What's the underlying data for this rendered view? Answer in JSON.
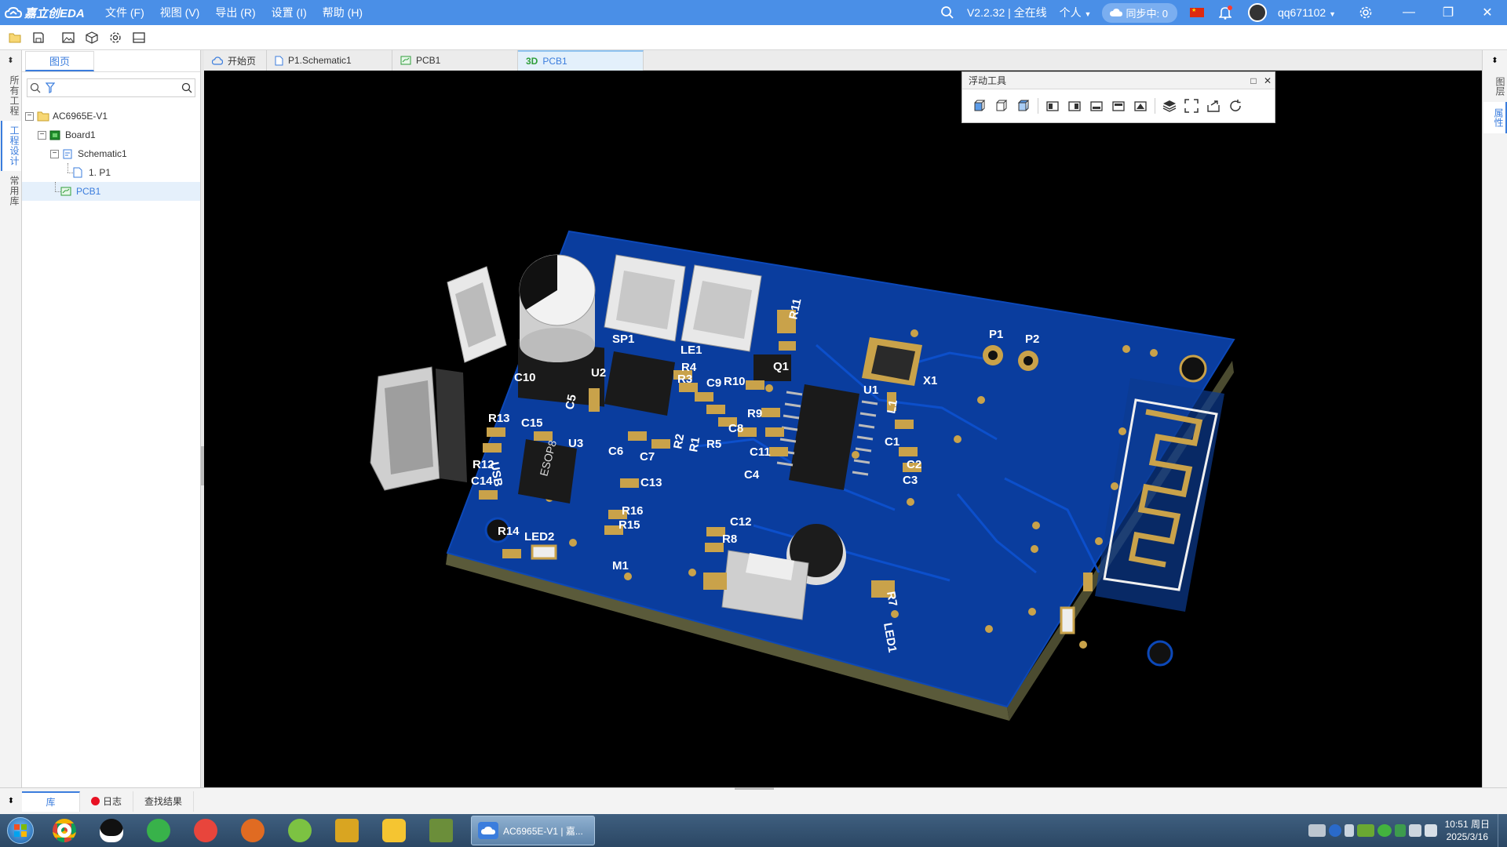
{
  "app": {
    "logo_text": "嘉立创EDA",
    "menus": [
      "文件 (F)",
      "视图 (V)",
      "导出 (R)",
      "设置 (I)",
      "帮助 (H)"
    ],
    "version_status": "V2.2.32 | 全在线",
    "workspace": "个人",
    "sync_label": "同步中: 0",
    "username": "qq671102",
    "accent_color": "#4a8fe7"
  },
  "left_strip": {
    "tabs": [
      "所有工程",
      "工程设计",
      "常用库"
    ],
    "active": 1
  },
  "left_panel": {
    "tab": "图页",
    "search_value": "",
    "tree": [
      {
        "label": "AC6965E-V1",
        "level": 0,
        "icon": "folder-icon",
        "expanded": true
      },
      {
        "label": "Board1",
        "level": 1,
        "icon": "board-icon",
        "expanded": true
      },
      {
        "label": "Schematic1",
        "level": 2,
        "icon": "schematic-icon",
        "expanded": true
      },
      {
        "label": "1. P1",
        "level": 3,
        "icon": "page-icon"
      },
      {
        "label": "PCB1",
        "level": 2,
        "icon": "pcb-icon",
        "selected": true
      }
    ]
  },
  "doc_tabs": [
    {
      "label": "开始页",
      "icon": "home-cloud-icon"
    },
    {
      "label": "P1.Schematic1",
      "icon": "page-icon"
    },
    {
      "label": "PCB1",
      "icon": "pcb-icon"
    },
    {
      "label": "PCB1",
      "icon": "3d-label",
      "prefix": "3D",
      "active": true
    }
  ],
  "float_tools": {
    "title": "浮动工具"
  },
  "right_strip": {
    "tabs": [
      "图层",
      "属性"
    ],
    "active": 1
  },
  "bottom_tabs": [
    {
      "label": "库",
      "active": true
    },
    {
      "label": "日志",
      "dot": true
    },
    {
      "label": "查找结果"
    }
  ],
  "pcb": {
    "board_color": "#0a3d9e",
    "labels": [
      "C10",
      "SP1",
      "LE1",
      "R11",
      "P1",
      "P2",
      "U2",
      "R4",
      "R3",
      "C9",
      "R10",
      "Q1",
      "U1",
      "X1",
      "C5",
      "R13",
      "C15",
      "U3",
      "C6",
      "C7",
      "R2",
      "R1",
      "R5",
      "C8",
      "R9",
      "C11",
      "C4",
      "L1",
      "C1",
      "C2",
      "C3",
      "USB",
      "R12",
      "C14",
      "ESOP8",
      "C13",
      "R16",
      "R15",
      "C12",
      "R8",
      "R14",
      "LED2",
      "M1",
      "R7",
      "LED1"
    ]
  },
  "taskbar": {
    "active_app": "AC6965E-V1 | 嘉...",
    "time": "10:51 周日",
    "date": "2025/3/16"
  }
}
